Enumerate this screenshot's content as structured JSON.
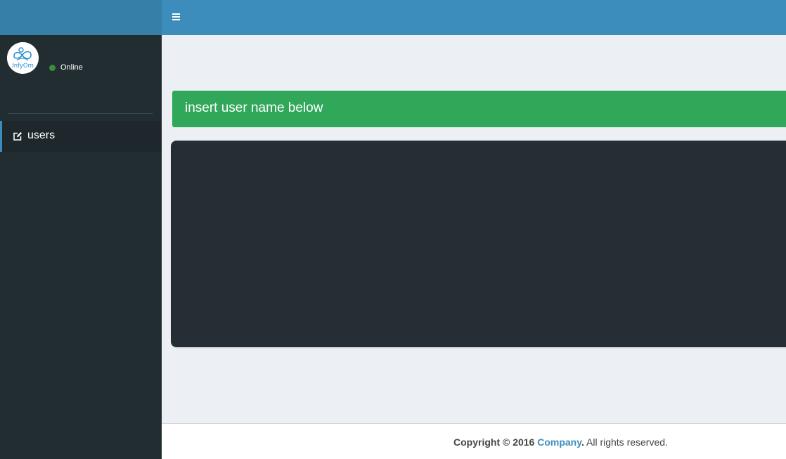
{
  "header": {
    "toggle_icon": "hamburger-menu-icon"
  },
  "sidebar": {
    "user": {
      "avatar_icon": "infyom-logo",
      "avatar_text": "InfyOm",
      "status_label": "Online",
      "status_color": "#3d8b3d"
    },
    "items": [
      {
        "icon": "edit-icon",
        "label": "users"
      }
    ]
  },
  "main": {
    "callout_text": "insert user name below",
    "callout_color": "#31a75a"
  },
  "footer": {
    "copyright": "Copyright © 2016",
    "company_link": "Company",
    "dot": ".",
    "rights": " All rights reserved."
  },
  "colors": {
    "header_logo_bg": "#367fa9",
    "header_bg": "#3c8dbc",
    "sidebar_bg": "#222d32",
    "content_bg": "#ecf0f5",
    "dark_panel_bg": "#272d34"
  }
}
